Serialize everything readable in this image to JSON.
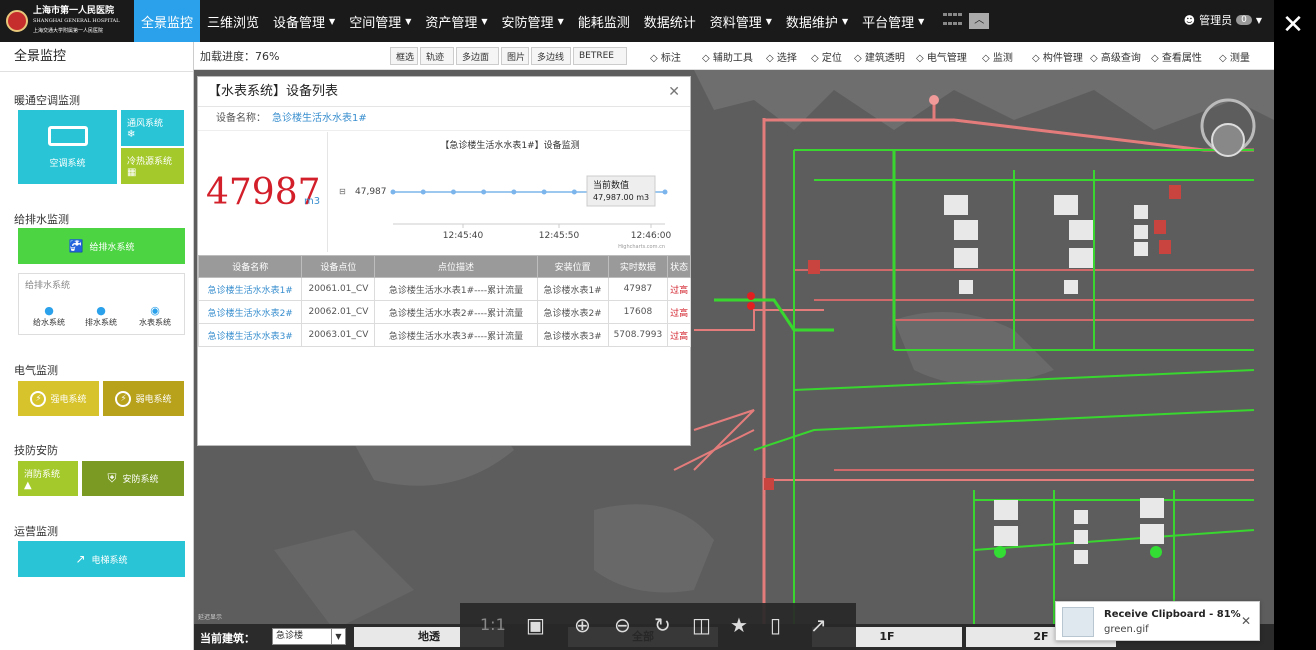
{
  "header": {
    "logo_title": "上海市第一人民医院",
    "logo_sub1": "SHANGHAI GENERAL HOSPITAL",
    "logo_sub2": "上海交通大学附属第一人民医院",
    "nav": [
      {
        "label": "全景监控",
        "active": true,
        "caret": false
      },
      {
        "label": "三维浏览",
        "caret": false
      },
      {
        "label": "设备管理",
        "caret": true
      },
      {
        "label": "空间管理",
        "caret": true
      },
      {
        "label": "资产管理",
        "caret": true
      },
      {
        "label": "安防管理",
        "caret": true
      },
      {
        "label": "能耗监测",
        "caret": false
      },
      {
        "label": "数据统计",
        "caret": false
      },
      {
        "label": "资料管理",
        "caret": true
      },
      {
        "label": "数据维护",
        "caret": true
      },
      {
        "label": "平台管理",
        "caret": true
      }
    ],
    "user_label": "管理员",
    "user_count": "0"
  },
  "sidebar": {
    "title": "全景监控",
    "sections": {
      "hvac": "暖通空调监测",
      "water": "给排水监测",
      "electric": "电气监测",
      "security": "技防安防",
      "operation": "运营监测"
    },
    "tiles": {
      "ac": "空调系统",
      "ventilation": "通风系统",
      "chiller": "冷热源系统",
      "water_system": "给排水系统",
      "water_sub_title": "给排水系统",
      "supply": "给水系统",
      "drain": "排水系统",
      "meter": "水表系统",
      "strong": "强电系统",
      "weak": "弱电系统",
      "fire": "消防系统",
      "defense": "安防系统",
      "elevator": "电梯系统"
    }
  },
  "mapbar": {
    "progress": "加载进度：76%",
    "buttons": [
      "框选",
      "轨迹",
      "多边面",
      "图片",
      "多边线",
      "BETREE"
    ],
    "tools": [
      "标注",
      "辅助工具",
      "选择",
      "定位",
      "建筑透明",
      "电气管理",
      "监测",
      "构件管理",
      "高级查询",
      "查看属性",
      "测量"
    ]
  },
  "panel": {
    "title": "【水表系统】设备列表",
    "device_label": "设备名称：",
    "device_value": "急诊楼生活水水表1#",
    "big_value": "47987",
    "big_unit": "m3",
    "table_headers": [
      "设备名称",
      "设备点位",
      "点位描述",
      "安装位置",
      "实时数据",
      "状态"
    ],
    "rows": [
      [
        "急诊楼生活水水表1#",
        "20061.01_CV",
        "急诊楼生活水水表1#----累计流量",
        "急诊楼水表1#",
        "47987",
        "过高"
      ],
      [
        "急诊楼生活水水表2#",
        "20062.01_CV",
        "急诊楼生活水水表2#----累计流量",
        "急诊楼水表2#",
        "17608",
        "过高"
      ],
      [
        "急诊楼生活水水表3#",
        "20063.01_CV",
        "急诊楼生活水水表3#----累计流量",
        "急诊楼水表3#",
        "5708.7993",
        "过高"
      ]
    ]
  },
  "chart_data": {
    "type": "line",
    "title": "【急诊楼生活水水表1#】设备监测",
    "x": [
      "12:45:40",
      "12:45:50",
      "12:46:00"
    ],
    "series": [
      {
        "values": [
          47987,
          47987,
          47987,
          47987,
          47987,
          47987,
          47987,
          47987,
          47987,
          47987
        ]
      }
    ],
    "y_tick": "47,987",
    "tooltip_title": "当前数值",
    "tooltip_value": "47,987.00 m3",
    "credit": "Highcharts.com.cn"
  },
  "bottom": {
    "current_label": "当前建筑：",
    "building": "急诊楼",
    "floors": [
      "地透",
      "全部",
      "1F",
      "2F"
    ],
    "zoom_label": "1:1",
    "map_credit": "延迟显示"
  },
  "notify": {
    "title": "Receive Clipboard - 81%",
    "file": "green.gif"
  },
  "colors": {
    "nav_active": "#2aa1ea",
    "alarm": "#d21f2a",
    "link": "#3a8fcf"
  }
}
